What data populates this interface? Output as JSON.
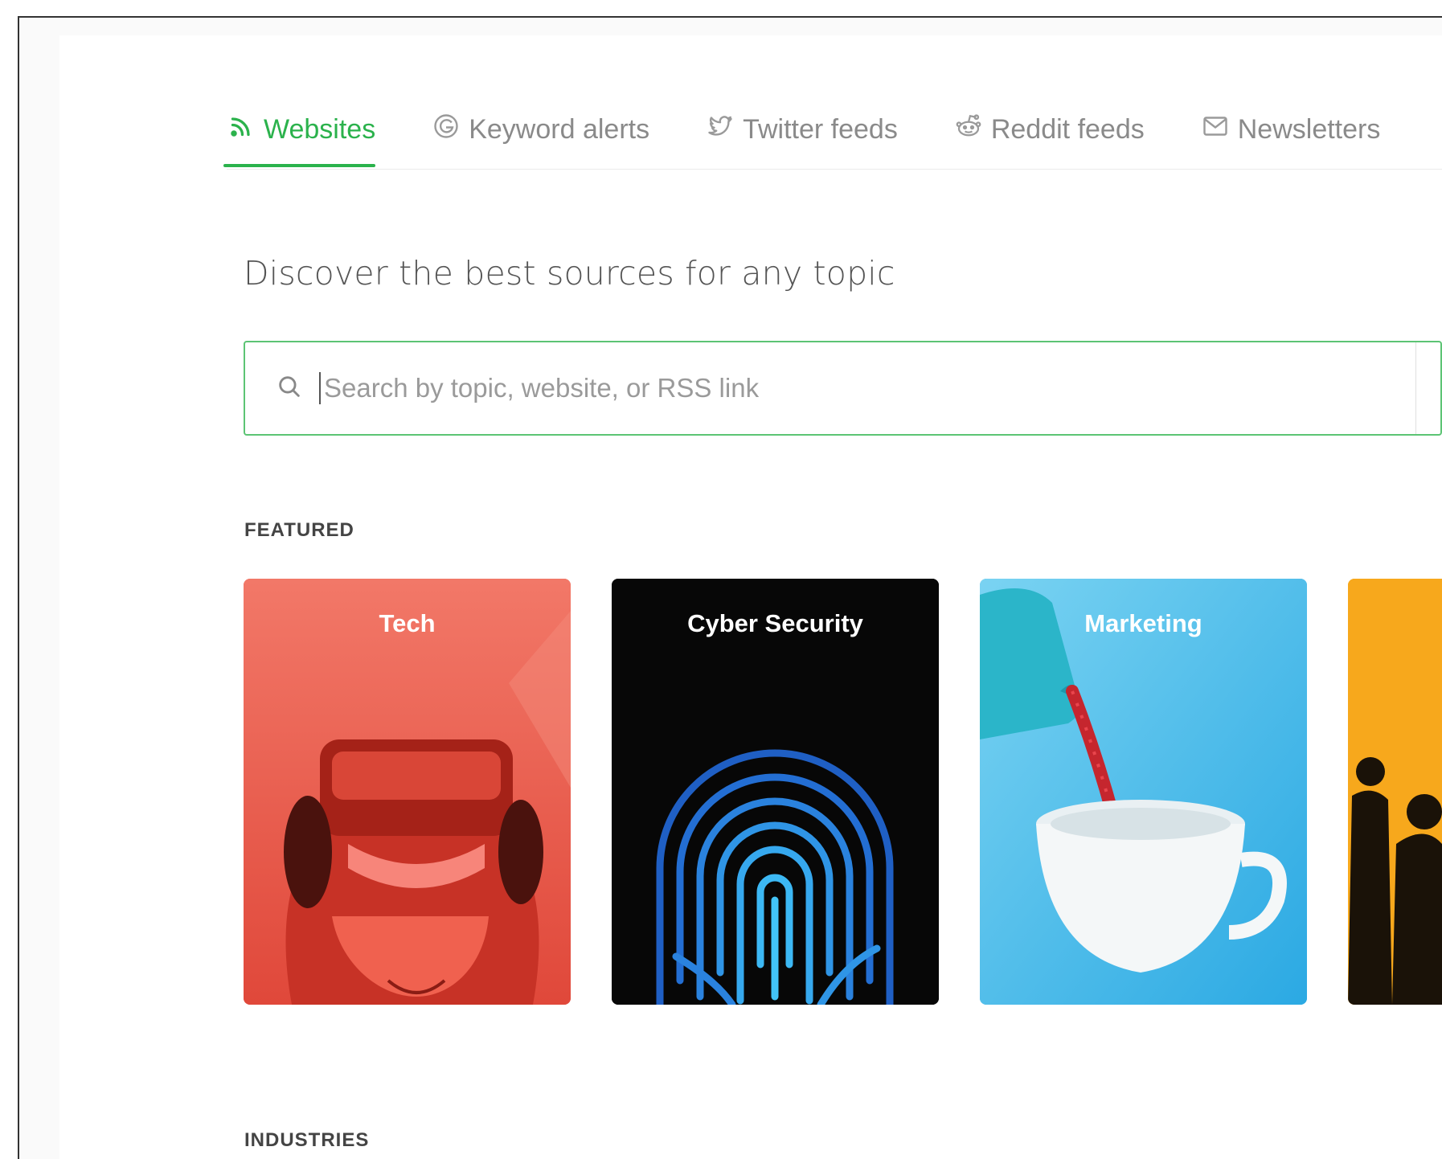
{
  "tabs": [
    {
      "label": "Websites",
      "icon": "rss-icon",
      "active": true
    },
    {
      "label": "Keyword alerts",
      "icon": "google-icon",
      "active": false
    },
    {
      "label": "Twitter feeds",
      "icon": "twitter-icon",
      "active": false
    },
    {
      "label": "Reddit feeds",
      "icon": "reddit-icon",
      "active": false
    },
    {
      "label": "Newsletters",
      "icon": "mail-icon",
      "active": false
    }
  ],
  "headline": "Discover the best sources for any topic",
  "search": {
    "placeholder": "Search by topic, website, or RSS link",
    "icon": "search-icon",
    "border_color": "#5cc474"
  },
  "featured": {
    "label": "FEATURED",
    "cards": [
      {
        "title": "Tech",
        "color": "#ef6c5c"
      },
      {
        "title": "Cyber Security",
        "color": "#070707"
      },
      {
        "title": "Marketing",
        "color": "#4fc0ea"
      },
      {
        "title": "",
        "color": "#f7a81c"
      }
    ]
  },
  "industries": {
    "label": "INDUSTRIES"
  },
  "accent_color": "#2bb24c"
}
